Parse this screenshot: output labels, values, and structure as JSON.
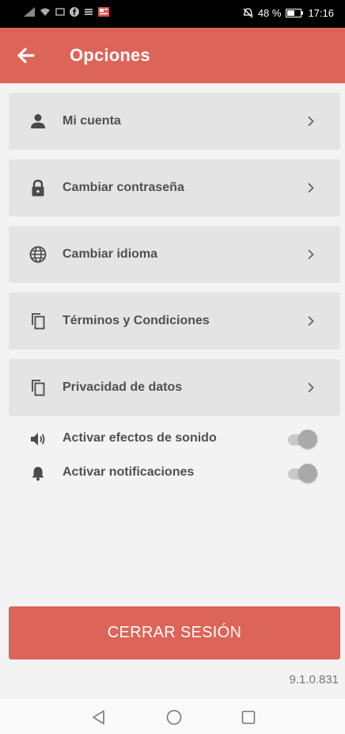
{
  "status_bar": {
    "battery": "48 %",
    "time": "17:16"
  },
  "header": {
    "title": "Opciones",
    "back_icon": "arrow-back-icon"
  },
  "menu": [
    {
      "label": "Mi cuenta",
      "icon": "person-icon"
    },
    {
      "label": "Cambiar contraseña",
      "icon": "lock-icon"
    },
    {
      "label": "Cambiar idioma",
      "icon": "globe-icon"
    },
    {
      "label": "Términos y Condiciones",
      "icon": "copy-icon"
    },
    {
      "label": "Privacidad de datos",
      "icon": "copy-icon"
    }
  ],
  "toggles": [
    {
      "label": "Activar efectos de sonido",
      "icon": "volume-icon",
      "state": "on"
    },
    {
      "label": "Activar notificaciones",
      "icon": "bell-icon",
      "state": "on"
    }
  ],
  "logout": {
    "label": "CERRAR SESIÓN"
  },
  "version": "9.1.0.831",
  "colors": {
    "accent": "#dd6458",
    "item_bg": "#e4e4e4",
    "page_bg": "#f3f3f3",
    "text": "#505050"
  }
}
